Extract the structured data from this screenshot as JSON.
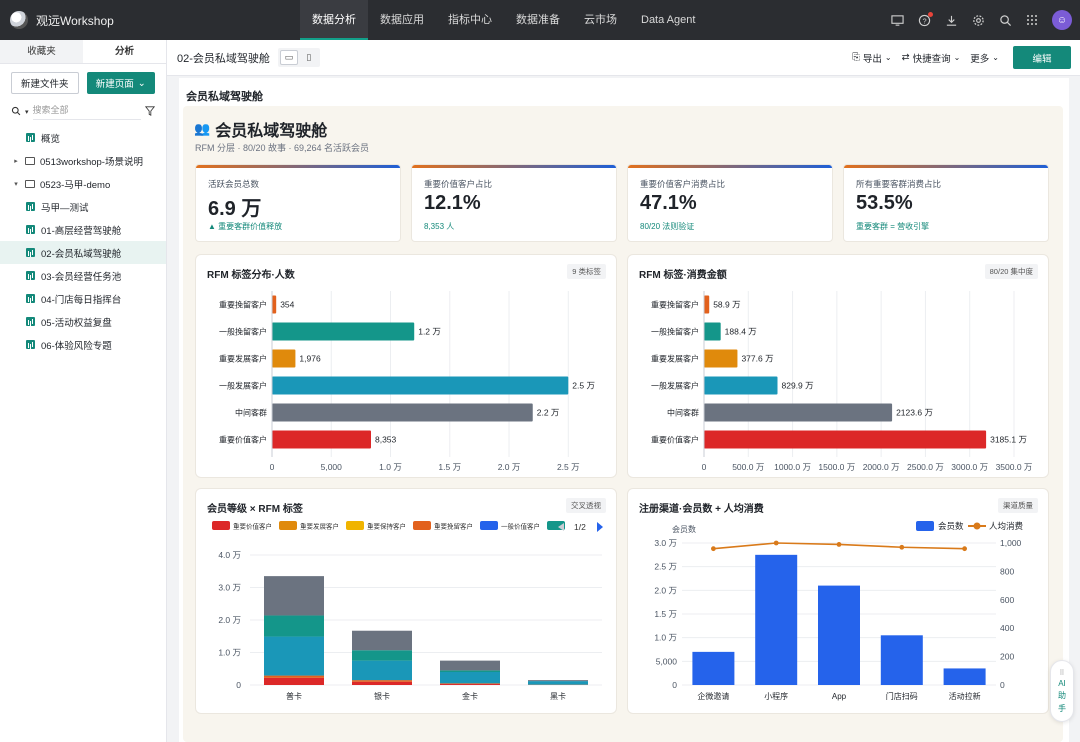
{
  "app": {
    "name": "观远Workshop"
  },
  "topnav": [
    {
      "label": "数据分析",
      "active": true
    },
    {
      "label": "数据应用"
    },
    {
      "label": "指标中心"
    },
    {
      "label": "数据准备"
    },
    {
      "label": "云市场"
    },
    {
      "label": "Data Agent"
    }
  ],
  "top_icons": [
    "monitor-icon",
    "help-icon",
    "download-icon",
    "gear-icon",
    "search-icon",
    "apps-grid-icon"
  ],
  "sidebar": {
    "tabs": [
      "收藏夹",
      "分析"
    ],
    "new_folder": "新建文件夹",
    "new_page": "新建页面",
    "search_placeholder": "搜索全部",
    "items": [
      {
        "label": "概览",
        "type": "report",
        "level": 1
      },
      {
        "label": "0513workshop-场景说明",
        "type": "folder",
        "level": 0,
        "expanded": false
      },
      {
        "label": "0523-马甲-demo",
        "type": "folder",
        "level": 0,
        "expanded": true
      },
      {
        "label": "马甲—测试",
        "type": "report",
        "level": 1
      },
      {
        "label": "01-高层经营驾驶舱",
        "type": "report",
        "level": 1
      },
      {
        "label": "02-会员私域驾驶舱",
        "type": "report",
        "level": 1,
        "active": true
      },
      {
        "label": "03-会员经营任务池",
        "type": "report",
        "level": 1
      },
      {
        "label": "04-门店每日指挥台",
        "type": "report",
        "level": 1
      },
      {
        "label": "05-活动权益复盘",
        "type": "report",
        "level": 1
      },
      {
        "label": "06-体验风险专题",
        "type": "report",
        "level": 1
      }
    ]
  },
  "header": {
    "page_name": "02-会员私域驾驶舱",
    "export": "导出",
    "quick_query": "快捷查询",
    "more": "更多",
    "edit": "编辑"
  },
  "canvas": {
    "title": "会员私域驾驶舱",
    "dash_title": "会员私域驾驶舱",
    "dash_subtitle": "RFM 分层 · 80/20 故事 · 69,264 名活跃会员"
  },
  "kpis": [
    {
      "label": "活跃会员总数",
      "value": "6.9 万",
      "note": "▲ 重要客群价值释放"
    },
    {
      "label": "重要价值客户占比",
      "value": "12.1%",
      "note": "8,353 人"
    },
    {
      "label": "重要价值客户消费占比",
      "value": "47.1%",
      "note": "80/20 法则验证"
    },
    {
      "label": "所有重要客群消费占比",
      "value": "53.5%",
      "note": "重要客群 = 营收引擎"
    }
  ],
  "ai_assistant": {
    "label1": "AI",
    "label2": "助",
    "label3": "手"
  },
  "chart_data": [
    {
      "type": "bar",
      "orientation": "horizontal",
      "title": "RFM 标签分布·人数",
      "tag": "9 类标签",
      "categories": [
        "重要挽留客户",
        "一般挽留客户",
        "重要发展客户",
        "一般发展客户",
        "中间客群",
        "重要价值客户"
      ],
      "values": [
        354,
        12000,
        1976,
        25000,
        22000,
        8353
      ],
      "data_labels": [
        "354",
        "1.2 万",
        "1,976",
        "2.5 万",
        "2.2 万",
        "8,353"
      ],
      "colors": [
        "#e2611d",
        "#14968a",
        "#e08a0c",
        "#1a97b8",
        "#6b7380",
        "#dc2828"
      ],
      "xlim": [
        0,
        27000
      ],
      "xticks": [
        0,
        5000,
        10000,
        15000,
        20000,
        25000
      ],
      "xtick_labels": [
        "0",
        "5,000",
        "1.0 万",
        "1.5 万",
        "2.0 万",
        "2.5 万"
      ],
      "grid": true
    },
    {
      "type": "bar",
      "orientation": "horizontal",
      "title": "RFM 标签·消费金额",
      "tag": "80/20 集中度",
      "categories": [
        "重要挽留客户",
        "一般挽留客户",
        "重要发展客户",
        "一般发展客户",
        "中间客群",
        "重要价值客户"
      ],
      "values": [
        58.9,
        188.4,
        377.6,
        829.9,
        2123.6,
        3185.1
      ],
      "data_labels": [
        "58.9 万",
        "188.4 万",
        "377.6 万",
        "829.9 万",
        "2123.6 万",
        "3185.1 万"
      ],
      "colors": [
        "#e2611d",
        "#14968a",
        "#e08a0c",
        "#1a97b8",
        "#6b7380",
        "#dc2828"
      ],
      "xlim": [
        0,
        3500
      ],
      "xticks": [
        0,
        500,
        1000,
        1500,
        2000,
        2500,
        3000,
        3500
      ],
      "xtick_labels": [
        "0",
        "500.0 万",
        "1000.0 万",
        "1500.0 万",
        "2000.0 万",
        "2500.0 万",
        "3000.0 万",
        "3500.0 万"
      ],
      "grid": true
    },
    {
      "type": "bar",
      "stacked": true,
      "title": "会员等级 × RFM 标签",
      "tag": "交叉透视",
      "categories": [
        "普卡",
        "银卡",
        "金卡",
        "黑卡"
      ],
      "legend": [
        {
          "name": "重要价值客户",
          "color": "#dc2828"
        },
        {
          "name": "重要发展客户",
          "color": "#e08a0c"
        },
        {
          "name": "重要保持客户",
          "color": "#f0b400"
        },
        {
          "name": "重要挽留客户",
          "color": "#e2611d"
        },
        {
          "name": "一般价值客户",
          "color": "#2563eb"
        },
        {
          "name": "",
          "color": "#14968a"
        }
      ],
      "legend_page": "1/2",
      "series": [
        {
          "color": "#dc2828",
          "values": [
            2200,
            1000,
            300,
            0
          ]
        },
        {
          "color": "#e2611d",
          "values": [
            700,
            500,
            200,
            100
          ]
        },
        {
          "color": "#1a97b8",
          "values": [
            12000,
            6000,
            3500,
            1100
          ]
        },
        {
          "color": "#14968a",
          "values": [
            6500,
            3200,
            500,
            0
          ]
        },
        {
          "color": "#6b7380",
          "values": [
            12100,
            6000,
            3000,
            300
          ]
        }
      ],
      "ylim": [
        0,
        40000
      ],
      "yticks": [
        0,
        10000,
        20000,
        30000,
        40000
      ],
      "ytick_labels": [
        "0",
        "1.0 万",
        "2.0 万",
        "3.0 万",
        "4.0 万"
      ],
      "grid": true
    },
    {
      "type": "bar+line",
      "title": "注册渠道·会员数 + 人均消费",
      "tag": "渠道质量",
      "categories": [
        "企微邀请",
        "小程序",
        "App",
        "门店扫码",
        "活动拉新"
      ],
      "bar_series": {
        "name": "会员数",
        "color": "#2563eb",
        "values": [
          7000,
          27500,
          21000,
          10500,
          3500
        ]
      },
      "line_series": {
        "name": "人均消费",
        "color": "#d97a1a",
        "values": [
          960,
          1000,
          990,
          970,
          960
        ]
      },
      "y_left_label": "会员数",
      "y_left_lim": [
        0,
        30000
      ],
      "y_left_ticks": [
        0,
        5000,
        10000,
        15000,
        20000,
        25000,
        30000
      ],
      "y_left_tick_labels": [
        "0",
        "5,000",
        "1.0 万",
        "1.5 万",
        "2.0 万",
        "2.5 万",
        "3.0 万"
      ],
      "y_right_lim": [
        0,
        1000
      ],
      "y_right_ticks": [
        0,
        200,
        400,
        600,
        800,
        1000
      ],
      "y_right_tick_labels": [
        "0",
        "200",
        "400",
        "600",
        "800",
        "1,000"
      ],
      "grid": true
    }
  ]
}
